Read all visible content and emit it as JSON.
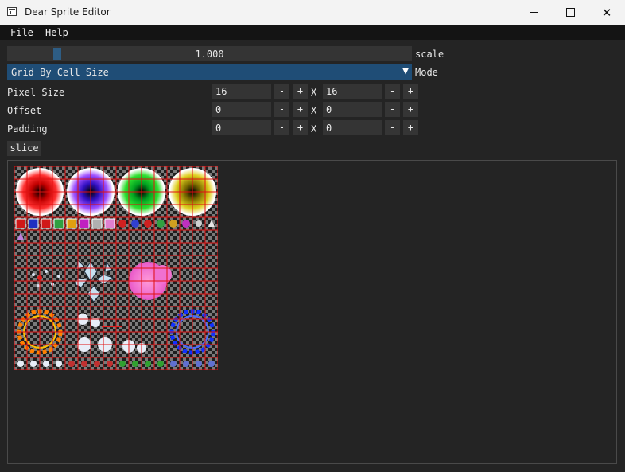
{
  "window": {
    "title": "Dear Sprite Editor",
    "icon": "app-icon"
  },
  "menu": {
    "file": "File",
    "help": "Help"
  },
  "scale": {
    "value": "1.000",
    "label": "scale",
    "fraction": 0.1
  },
  "mode": {
    "value": "Grid By Cell Size",
    "label": "Mode",
    "arrow": "▼"
  },
  "separator": "X",
  "rows": [
    {
      "id": "pixel-size",
      "label": "Pixel Size",
      "x": "16",
      "y": "16"
    },
    {
      "id": "offset",
      "label": "Offset",
      "x": "0",
      "y": "0"
    },
    {
      "id": "padding",
      "label": "Padding",
      "x": "0",
      "y": "0"
    }
  ],
  "stepper": {
    "minus": "-",
    "plus": "+"
  },
  "slice_button": "slice",
  "colors": {
    "grid": "#e01010",
    "accent": "#1f4d76",
    "grab": "#2e5d84"
  }
}
